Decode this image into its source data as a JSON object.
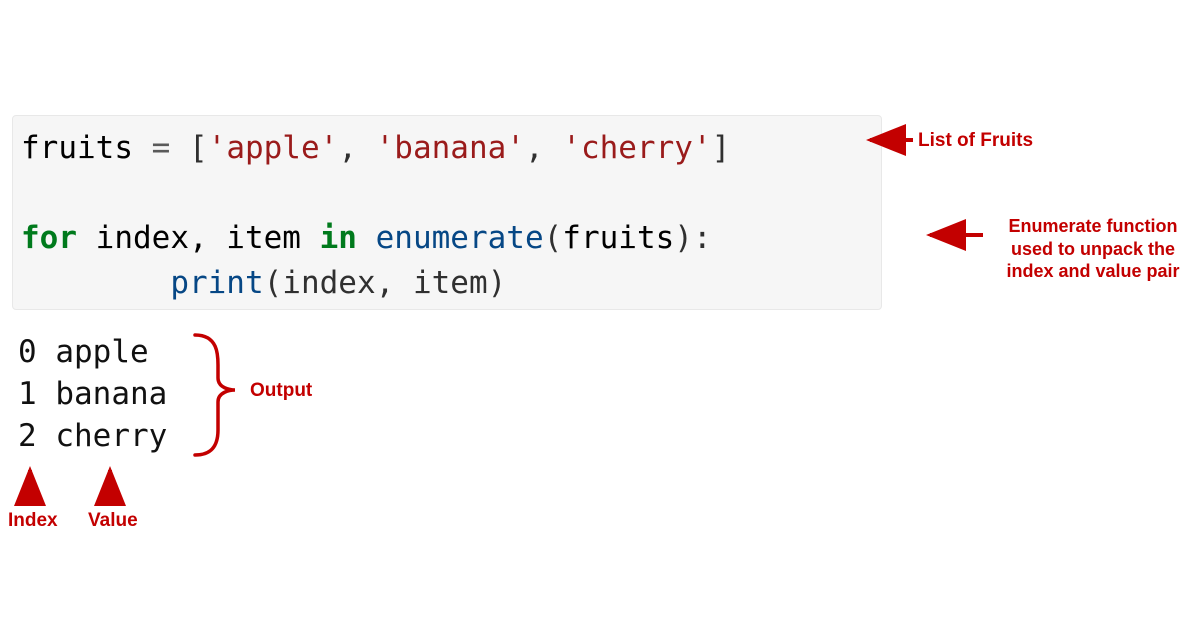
{
  "code": {
    "var_name": "fruits",
    "assign": " = ",
    "lbrack": "[",
    "rbrack": "]",
    "comma": ", ",
    "str1": "'apple'",
    "str2": "'banana'",
    "str3": "'cherry'",
    "blank": "",
    "for_kw": "for",
    "in_kw": "in",
    "iter_vars": " index, item ",
    "enum_fn": "enumerate",
    "call_open": "(",
    "call_arg": "fruits",
    "call_close": "):",
    "indent": "        ",
    "print_fn": "print",
    "print_args": "(index, item)"
  },
  "output": {
    "line1": "0 apple",
    "line2": "1 banana",
    "line3": "2 cherry"
  },
  "annotations": {
    "list_label": "List of Fruits",
    "enum_label": "Enumerate function used to unpack the index and value pair",
    "output_label": "Output",
    "index_label": "Index",
    "value_label": "Value"
  },
  "colors": {
    "annotation": "#c30000",
    "code_bg": "#f6f6f6",
    "keyword": "#007a1c",
    "function": "#064785",
    "string": "#9a1b1b"
  }
}
